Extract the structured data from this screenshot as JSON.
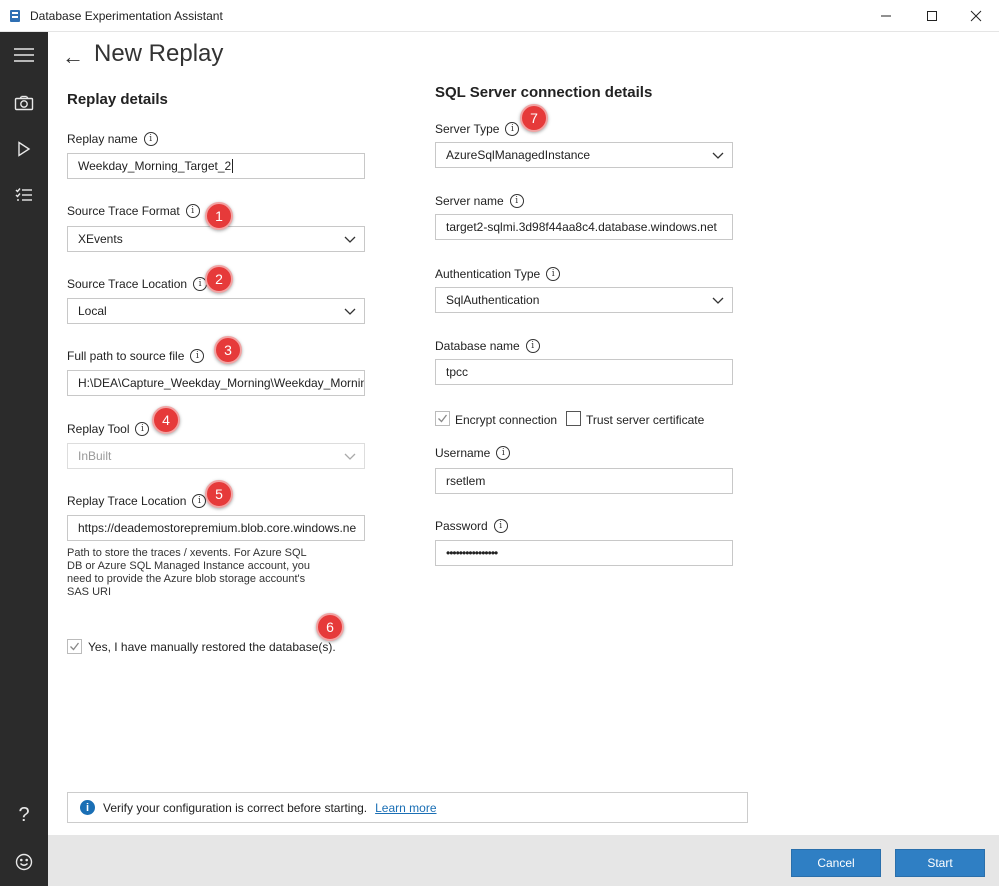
{
  "window": {
    "title": "Database Experimentation Assistant"
  },
  "sidebar": {
    "icons": [
      "menu-icon",
      "camera-icon",
      "play-icon",
      "checklist-icon",
      "help-icon",
      "smiley-icon"
    ],
    "help_glyph": "?"
  },
  "page": {
    "title": "New Replay",
    "back_glyph": "←"
  },
  "replay": {
    "heading": "Replay details",
    "replay_name_label": "Replay name",
    "replay_name_value": "Weekday_Morning_Target_2",
    "source_trace_format_label": "Source Trace Format",
    "source_trace_format_value": "XEvents",
    "source_trace_location_label": "Source Trace Location",
    "source_trace_location_value": "Local",
    "full_path_label": "Full path to source file",
    "full_path_value": "H:\\DEA\\Capture_Weekday_Morning\\Weekday_Mornin",
    "replay_tool_label": "Replay Tool",
    "replay_tool_value": "InBuilt",
    "replay_trace_location_label": "Replay Trace Location",
    "replay_trace_location_value": "https://deademostorepremium.blob.core.windows.ne",
    "replay_trace_hint": "Path to store the traces / xevents. For Azure SQL DB or Azure SQL Managed Instance account, you need to provide the Azure blob storage account's SAS URI",
    "restored_label": "Yes, I have manually restored the database(s).",
    "restored_checked": true
  },
  "sql": {
    "heading": "SQL Server connection details",
    "server_type_label": "Server Type",
    "server_type_value": "AzureSqlManagedInstance",
    "server_name_label": "Server name",
    "server_name_value": "target2-sqlmi.3d98f44aa8c4.database.windows.net",
    "auth_type_label": "Authentication Type",
    "auth_type_value": "SqlAuthentication",
    "database_name_label": "Database name",
    "database_name_value": "tpcc",
    "encrypt_label": "Encrypt connection",
    "encrypt_checked": true,
    "trust_label": "Trust server certificate",
    "trust_checked": false,
    "username_label": "Username",
    "username_value": "rsetlem",
    "password_label": "Password",
    "password_value": "••••••••••••••••"
  },
  "badges": [
    "1",
    "2",
    "3",
    "4",
    "5",
    "6",
    "7"
  ],
  "info_glyph": "i",
  "infobar": {
    "message": "Verify your configuration is correct before starting.",
    "link": "Learn more"
  },
  "footer": {
    "cancel_label": "Cancel",
    "start_label": "Start"
  },
  "colors": {
    "accent": "#2f7fc4",
    "sidebar": "#2b2b2b",
    "badge": "#e63a3a"
  }
}
